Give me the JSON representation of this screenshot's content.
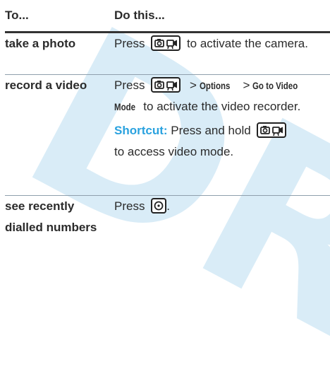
{
  "watermark": "DR",
  "table": {
    "col1_header": "To...",
    "col2_header": "Do this...",
    "row1": {
      "task": "take a photo",
      "press": "Press",
      "after_key": "to activate the camera."
    },
    "row2": {
      "task": "record a video",
      "press": "Press",
      "gt1": ">",
      "menu1": "Options",
      "gt2": ">",
      "menu2a": "Go to Video",
      "menu2b": "Mode",
      "after_menu": "to activate the video recorder.",
      "shortcut_label": "Shortcut:",
      "shortcut_text": "Press and hold",
      "shortcut_after": "to access video mode."
    },
    "row3": {
      "task": "see recently dialled numbers",
      "press": "Press",
      "after_key": "."
    }
  },
  "icons": {
    "camera_key": "camera-video-key-icon",
    "send_key": "center-select-key-icon"
  }
}
